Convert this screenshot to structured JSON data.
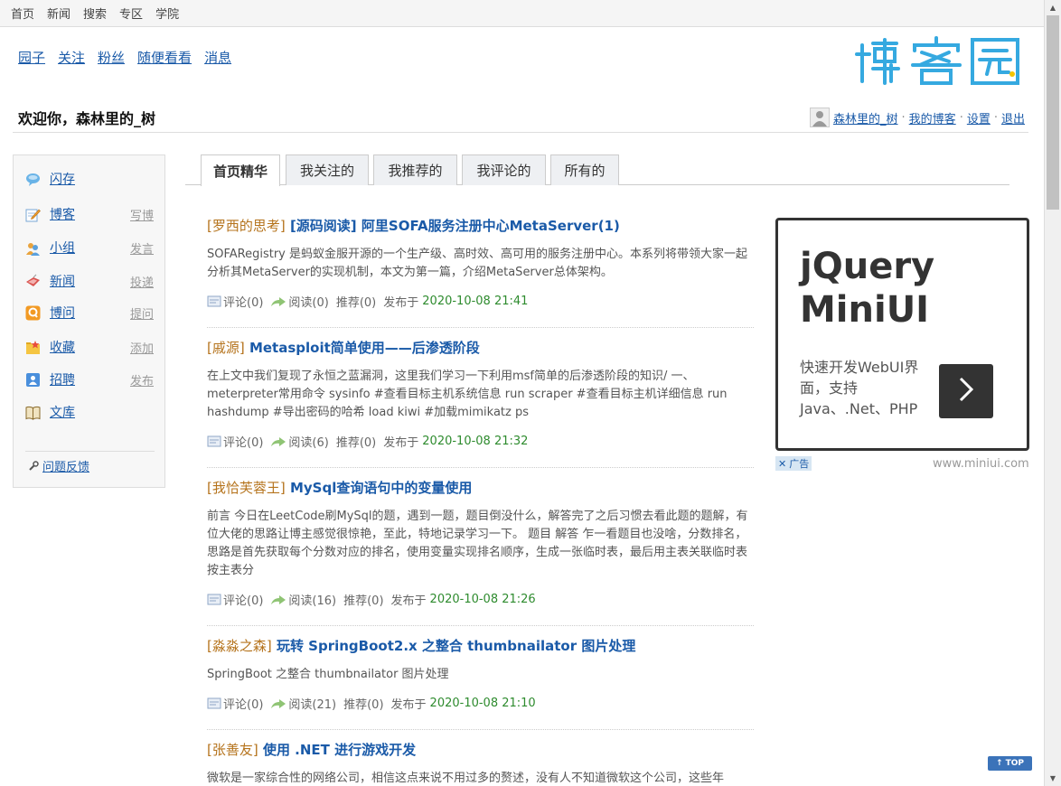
{
  "topnav": [
    "首页",
    "新闻",
    "搜索",
    "专区",
    "学院"
  ],
  "subnav": [
    "园子",
    "关注",
    "粉丝",
    "随便看看",
    "消息"
  ],
  "logo": {
    "text": "博客园"
  },
  "welcome": "欢迎你，森林里的_树",
  "userbar": {
    "username": "森林里的_树",
    "my_blog": "我的博客",
    "settings": "设置",
    "logout": "退出",
    "sep": "·"
  },
  "sidebar": {
    "items": [
      {
        "label": "闪存",
        "action": "",
        "icon": "chat-bubble-icon"
      },
      {
        "label": "博客",
        "action": "写博",
        "icon": "pencil-note-icon"
      },
      {
        "label": "小组",
        "action": "发言",
        "icon": "group-icon"
      },
      {
        "label": "新闻",
        "action": "投递",
        "icon": "news-icon"
      },
      {
        "label": "博问",
        "action": "提问",
        "icon": "question-icon"
      },
      {
        "label": "收藏",
        "action": "添加",
        "icon": "star-folder-icon"
      },
      {
        "label": "招聘",
        "action": "发布",
        "icon": "job-icon"
      },
      {
        "label": "文库",
        "action": "",
        "icon": "book-icon"
      }
    ],
    "feedback": "问题反馈"
  },
  "tabs": [
    "首页精华",
    "我关注的",
    "我推荐的",
    "我评论的",
    "所有的"
  ],
  "posts": [
    {
      "author": "[罗西的思考]",
      "title": "[源码阅读] 阿里SOFA服务注册中心MetaServer(1)",
      "summary": "SOFARegistry 是蚂蚁金服开源的一个生产级、高时效、高可用的服务注册中心。本系列将带领大家一起分析其MetaServer的实现机制，本文为第一篇，介绍MetaServer总体架构。",
      "comments": "评论(0)",
      "reads": "阅读(0)",
      "recommend": "推荐(0)",
      "posted": "发布于",
      "date": "2020-10-08 21:41"
    },
    {
      "author": "[戚源]",
      "title": "Metasploit简单使用——后渗透阶段",
      "summary": "在上文中我们复现了永恒之蓝漏洞，这里我们学习一下利用msf简单的后渗透阶段的知识/ 一、meterpreter常用命令 sysinfo #查看目标主机系统信息 run scraper #查看目标主机详细信息 run hashdump #导出密码的哈希 load kiwi #加载mimikatz ps",
      "comments": "评论(0)",
      "reads": "阅读(6)",
      "recommend": "推荐(0)",
      "posted": "发布于",
      "date": "2020-10-08 21:32"
    },
    {
      "author": "[我恰芙蓉王]",
      "title": "MySql查询语句中的变量使用",
      "summary": "前言 今日在LeetCode刷MySql的题，遇到一题，题目倒没什么，解答完了之后习惯去看此题的题解，有位大佬的思路让博主感觉很惊艳，至此，特地记录学习一下。 题目 解答 乍一看题目也没啥，分数排名，思路是首先获取每个分数对应的排名，使用变量实现排名顺序，生成一张临时表，最后用主表关联临时表按主表分",
      "comments": "评论(0)",
      "reads": "阅读(16)",
      "recommend": "推荐(0)",
      "posted": "发布于",
      "date": "2020-10-08 21:26"
    },
    {
      "author": "[淼淼之森]",
      "title": "玩转 SpringBoot2.x 之整合 thumbnailator 图片处理",
      "summary": "SpringBoot 之整合 thumbnailator 图片处理",
      "comments": "评论(0)",
      "reads": "阅读(21)",
      "recommend": "推荐(0)",
      "posted": "发布于",
      "date": "2020-10-08 21:10"
    },
    {
      "author": "[张善友]",
      "title": "使用 .NET 进行游戏开发",
      "summary": "微软是一家综合性的网络公司，相信这点来说不用过多的赘述，没有人不知道微软这个公司，这些年"
    }
  ],
  "ad": {
    "line1": "jQuery",
    "line2": "MiniUI",
    "desc": "快速开发WebUI界面，支持Java、.Net、PHP",
    "tag": "广告",
    "url": "www.miniui.com"
  },
  "totop": "↑ TOP",
  "colors": {
    "link": "#1a5aa8",
    "author": "#b5731c",
    "date": "#2e8b2e",
    "logo": "#35a9e0"
  }
}
